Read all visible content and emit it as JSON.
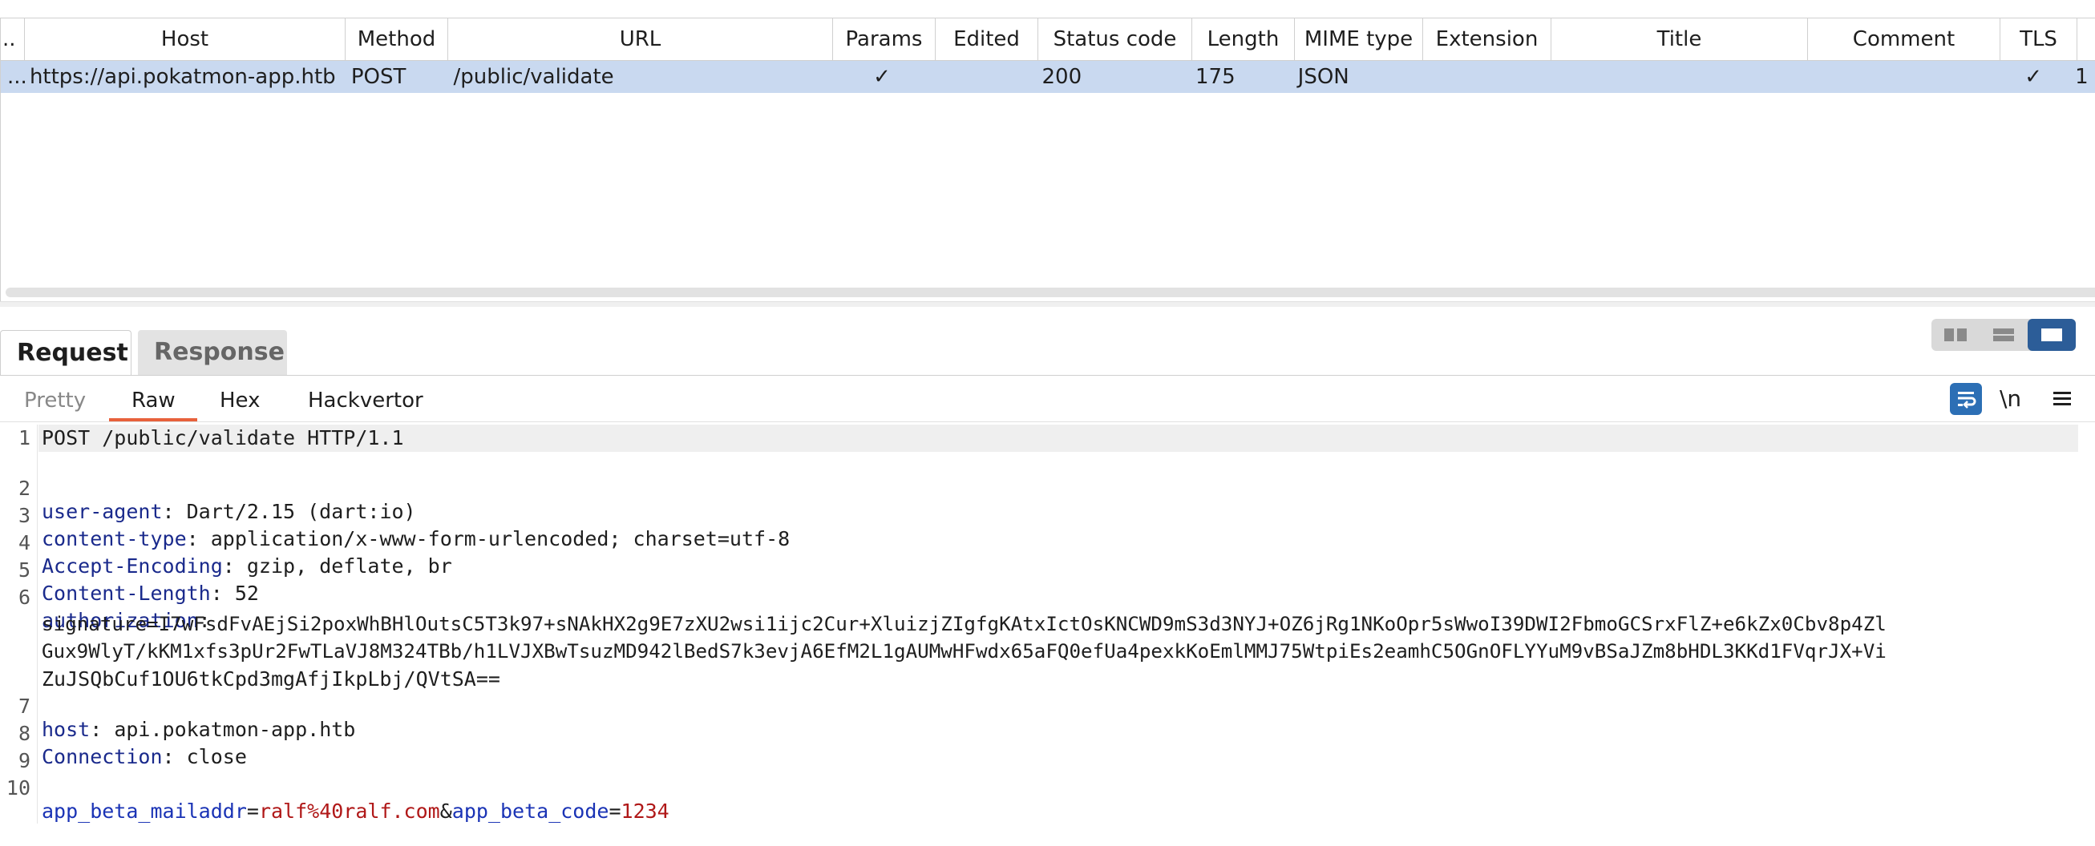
{
  "history": {
    "columns": [
      "..",
      "Host",
      "Method",
      "URL",
      "Params",
      "Edited",
      "Status code",
      "Length",
      "MIME type",
      "Extension",
      "Title",
      "Comment",
      "TLS"
    ],
    "row": {
      "num": "...",
      "host": "https://api.pokatmon-app.htb",
      "method": "POST",
      "url": "/public/validate",
      "params": "✓",
      "edited": "",
      "status": "200",
      "length": "175",
      "mime": "JSON",
      "extension": "",
      "title": "",
      "comment": "",
      "tls": "✓",
      "extra": "1"
    }
  },
  "tabs": {
    "request": "Request",
    "response": "Response"
  },
  "subtabs": {
    "pretty": "Pretty",
    "raw": "Raw",
    "hex": "Hex",
    "hackvertor": "Hackvertor"
  },
  "tools": {
    "newline": "\\n"
  },
  "request": {
    "line1": "POST /public/validate HTTP/1.1",
    "h_useragent_key": "user-agent",
    "h_useragent_val": ": Dart/2.15 (dart:io)",
    "h_ctype_key": "content-type",
    "h_ctype_val": ": application/x-www-form-urlencoded; charset=utf-8",
    "h_accenc_key": "Accept-Encoding",
    "h_accenc_val": ": gzip, deflate, br",
    "h_clen_key": "Content-Length",
    "h_clen_val": ": 52",
    "h_auth_key": "authorization",
    "h_auth_val": ":",
    "auth_wrap1": "signature=I7wFsdFvAEjSi2poxWhBHlOutsC5T3k97+sNAkHX2g9E7zXU2wsi1ijc2Cur+XluizjZIgfgKAtxIctOsKNCWD9mS3d3NYJ+OZ6jRg1NKoOpr5sWwoI39DWI2FbmoGCSrxFlZ+e6kZx0Cbv8p4Zl",
    "auth_wrap2": "Gux9WlyT/kKM1xfs3pUr2FwTLaVJ8M324TBb/h1LVJXBwTsuzMD942lBedS7k3evjA6EfM2L1gAUMwHFwdx65aFQ0efUa4pexkKoEmlMMJ75WtpiEs2eamhC5OGnOFLYYuM9vBSaJZm8bHDL3KKd1FVqrJX+Vi",
    "auth_wrap3": "ZuJSQbCuf1OU6tkCpd3mgAfjIkpLbj/QVtSA==",
    "h_host_key": "host",
    "h_host_val": ": api.pokatmon-app.htb",
    "h_conn_key": "Connection",
    "h_conn_val": ": close",
    "body_k1": "app_beta_mailaddr",
    "body_eq1": "=",
    "body_v1": "ralf%40ralf.com",
    "body_amp": "&",
    "body_k2": "app_beta_code",
    "body_eq2": "=",
    "body_v2": "1234",
    "line_numbers": [
      "1",
      "2",
      "3",
      "4",
      "5",
      "6",
      "7",
      "8",
      "9",
      "10"
    ]
  },
  "colors": {
    "selected_row": "#c9d9f0",
    "accent_tab": "#e8613c",
    "toggle_blue": "#2c5d98"
  }
}
